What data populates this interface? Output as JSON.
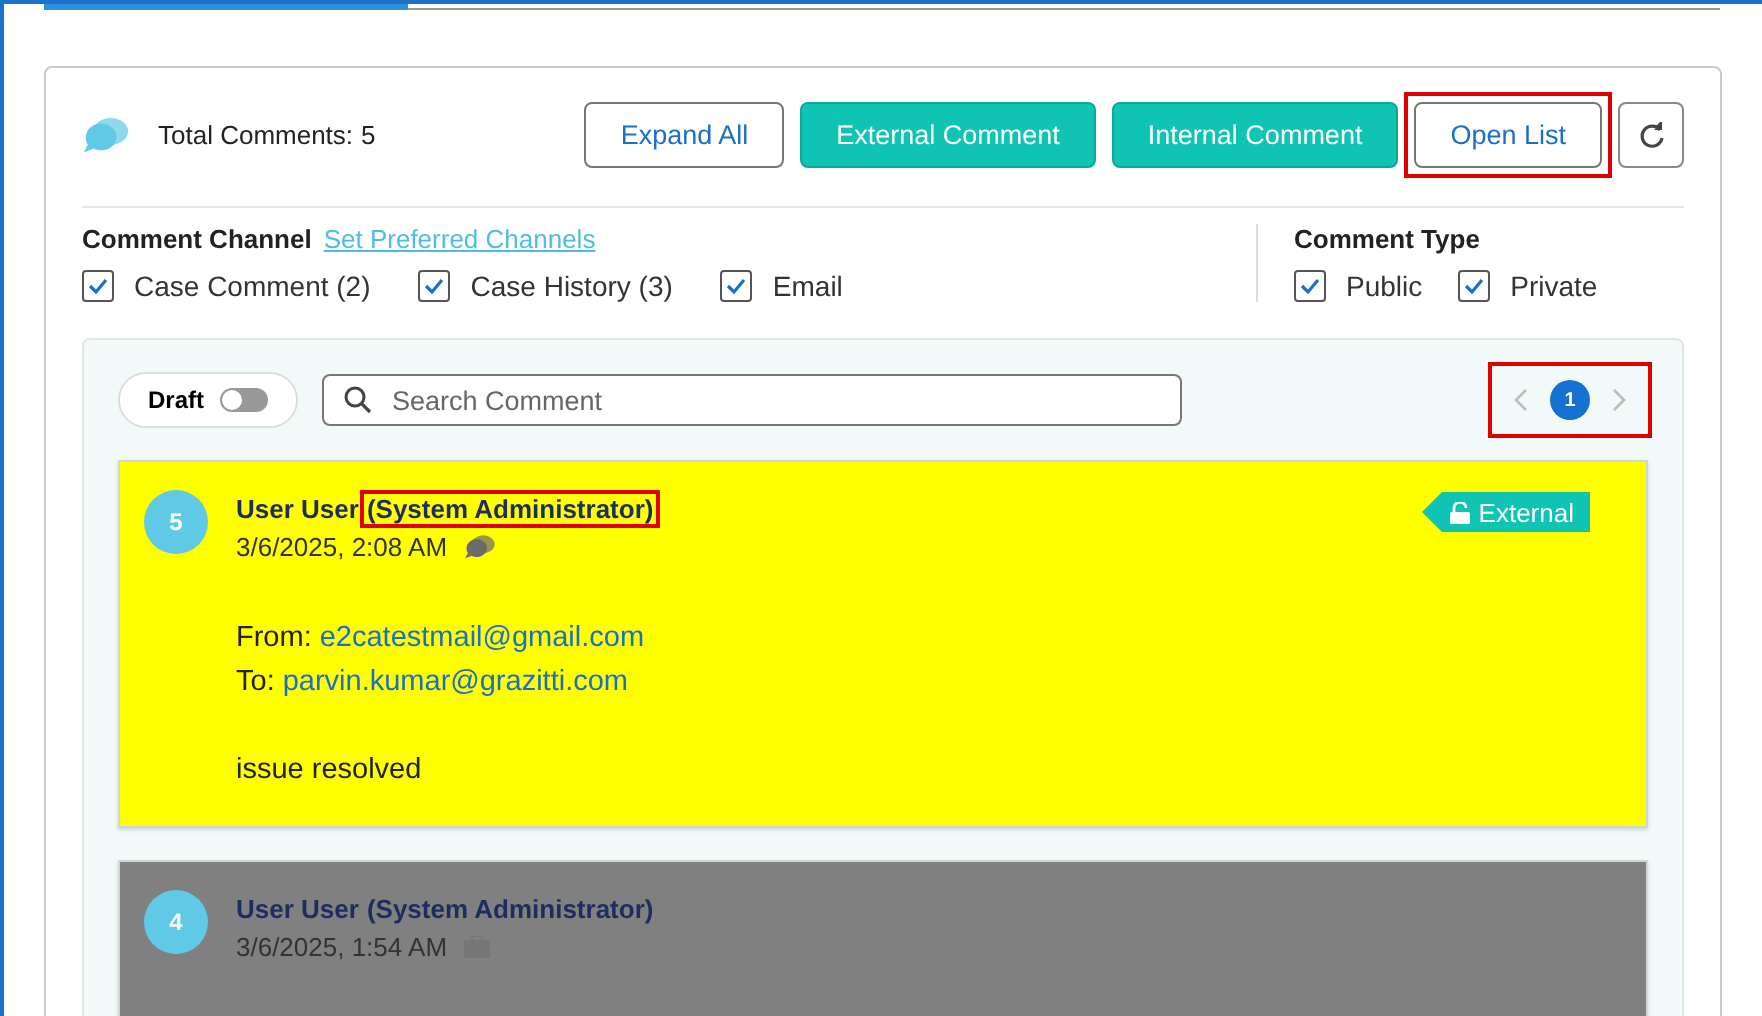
{
  "tabs": [
    {
      "selected": true
    },
    {
      "selected": false
    }
  ],
  "header": {
    "title": "Total Comments:",
    "count": "5",
    "buttons": [
      {
        "label": "Expand All",
        "kind": "outline"
      },
      {
        "label": "External Comment",
        "kind": "primary"
      },
      {
        "label": "Internal Comment",
        "kind": "primary"
      },
      {
        "label": "Open List",
        "kind": "outline",
        "highlighted": true
      }
    ]
  },
  "channels": {
    "title": "Comment Channel",
    "link": "Set Preferred Channels",
    "options": [
      {
        "label": "Case Comment (2)",
        "checked": true
      },
      {
        "label": "Case History (3)",
        "checked": true
      },
      {
        "label": "Email",
        "checked": true
      }
    ]
  },
  "comment_type": {
    "title": "Comment Type",
    "options": [
      {
        "label": "Public",
        "checked": true
      },
      {
        "label": "Private",
        "checked": true
      }
    ]
  },
  "toolbar": {
    "draft": {
      "label": "Draft",
      "on": false
    },
    "search": {
      "placeholder": "Search Comment"
    },
    "pagination": {
      "pages": [
        {
          "label": "1",
          "selected": true
        }
      ],
      "highlighted": true
    }
  },
  "comments": [
    {
      "number": "5",
      "author": "User User",
      "role": "(System Administrator)",
      "role_highlighted": true,
      "date": "3/6/2025, 2:08 AM",
      "kind": "chat",
      "color": "#ffff00",
      "badge": "External",
      "lines": [
        {
          "label": "From:",
          "value": "e2catestmail@gmail.com"
        },
        {
          "label": "To:",
          "value": "parvin.kumar@grazitti.com"
        }
      ],
      "body": "issue resolved"
    },
    {
      "number": "4",
      "author": "User User",
      "role": "(System Administrator)",
      "date": "3/6/2025, 1:54 AM",
      "kind": "case",
      "color": "#808080"
    }
  ]
}
